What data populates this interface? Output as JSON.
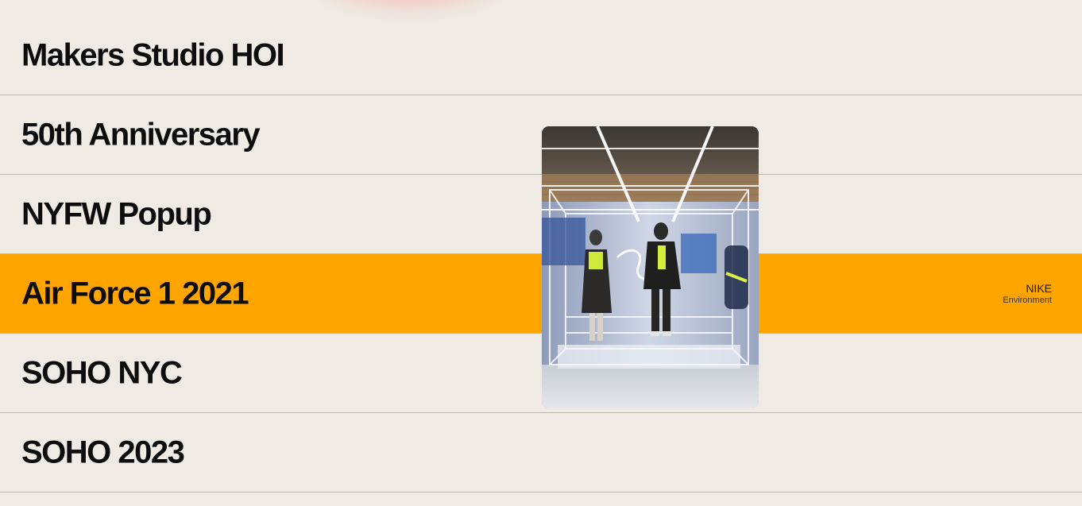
{
  "projects": [
    {
      "title": "Makers Studio HOI",
      "client": "",
      "kind": ""
    },
    {
      "title": "50th Anniversary",
      "client": "",
      "kind": ""
    },
    {
      "title": "NYFW Popup",
      "client": "",
      "kind": ""
    },
    {
      "title": "Air Force 1 2021",
      "client": "NIKE",
      "kind": "Environment"
    },
    {
      "title": "SOHO NYC",
      "client": "",
      "kind": ""
    },
    {
      "title": "SOHO 2023",
      "client": "",
      "kind": ""
    }
  ],
  "active_index": 3,
  "colors": {
    "background": "#efeae4",
    "active_row": "#ffa500",
    "divider": "#b9b5b0",
    "text": "#0d0d0d"
  }
}
